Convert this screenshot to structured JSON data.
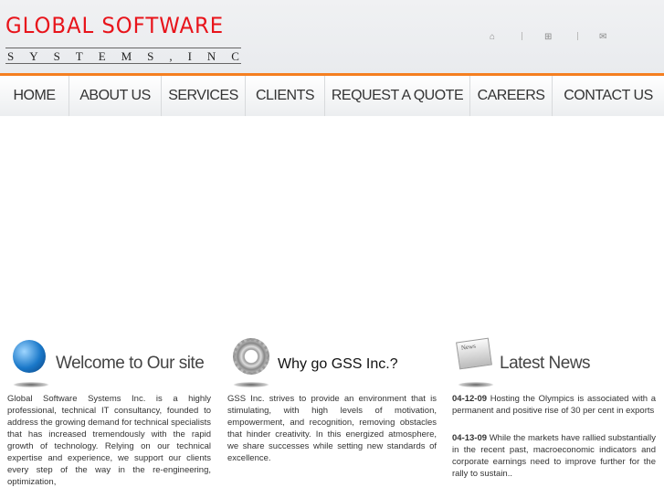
{
  "logo": {
    "line1": "GLOBAL SOFTWARE",
    "line2": [
      "S",
      "Y",
      "S",
      "T",
      "E",
      "M",
      "S",
      ",",
      "I",
      "N",
      "C"
    ]
  },
  "top_icons": [
    "home-icon",
    "sitemap-icon",
    "mail-icon"
  ],
  "nav": [
    "HOME",
    "ABOUT US",
    "SERVICES",
    "CLIENTS",
    "REQUEST A QUOTE",
    "CAREERS",
    "CONTACT US"
  ],
  "welcome": {
    "title": "Welcome to Our site",
    "text": "Global Software Systems Inc. is a highly professional, technical IT consultancy, founded to address the growing demand for technical specialists that has increased tremendously with the rapid growth of technology. Relying on our technical expertise and experience, we support our clients every step of the way in the re-engineering, optimization,"
  },
  "why": {
    "title": "Why go GSS Inc.?",
    "text": "GSS Inc. strives to provide an environment that is stimulating, with high levels of motivation, empowerment, and recognition, removing obstacles that hinder creativity. In this energized atmosphere, we share successes while setting new standards of excellence."
  },
  "news": {
    "title": "Latest News",
    "items": [
      {
        "date": "04-12-09",
        "text": " Hosting the Olympics is associated with a permanent and positive rise of 30 per cent in exports"
      },
      {
        "date": "04-13-09",
        "text": " While the markets have rallied substantially in the recent past, macroeconomic indicators and corporate earnings need to improve further for the rally to sustain.."
      }
    ]
  },
  "colors": {
    "accent": "#f57f20",
    "logo": "#e8141b"
  }
}
